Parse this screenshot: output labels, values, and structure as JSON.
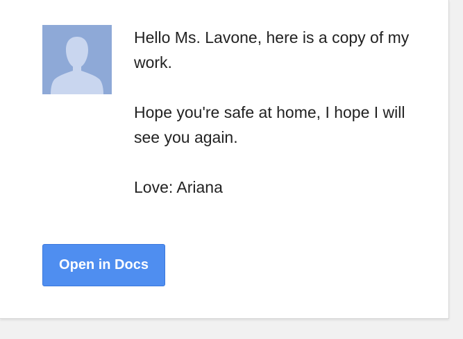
{
  "message": {
    "lines": [
      "Hello Ms. Lavone, here is a copy of my work.",
      "Hope you're safe at home, I hope I will see you again.",
      "Love: Ariana"
    ]
  },
  "actions": {
    "open_label": "Open in Docs"
  },
  "colors": {
    "avatar_background": "#8ea9d7",
    "avatar_silhouette": "#c9d6ef",
    "button_background": "#4f8ef0",
    "text": "#222222"
  },
  "icons": {
    "avatar": "person-silhouette-icon"
  }
}
